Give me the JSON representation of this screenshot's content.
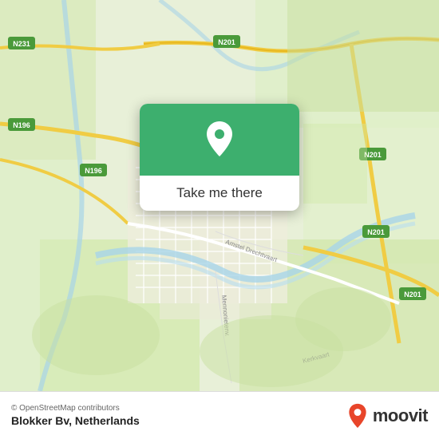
{
  "map": {
    "background_color": "#e8f0d8",
    "center_lat": 52.28,
    "center_lon": 4.84
  },
  "popup": {
    "button_label": "Take me there",
    "background_color": "#3daf6e",
    "pin_icon": "location-pin-icon"
  },
  "bottom_bar": {
    "osm_credit": "© OpenStreetMap contributors",
    "location_name": "Blokker Bv, Netherlands",
    "moovit_label": "moovit"
  },
  "road_labels": [
    "N231",
    "N201",
    "N196",
    "N201",
    "N201",
    "N201"
  ],
  "colors": {
    "map_green": "#3daf6e",
    "map_bg": "#e8f0d8",
    "road_yellow": "#f5d76e",
    "road_white": "#ffffff",
    "water_blue": "#b0d8f0"
  }
}
